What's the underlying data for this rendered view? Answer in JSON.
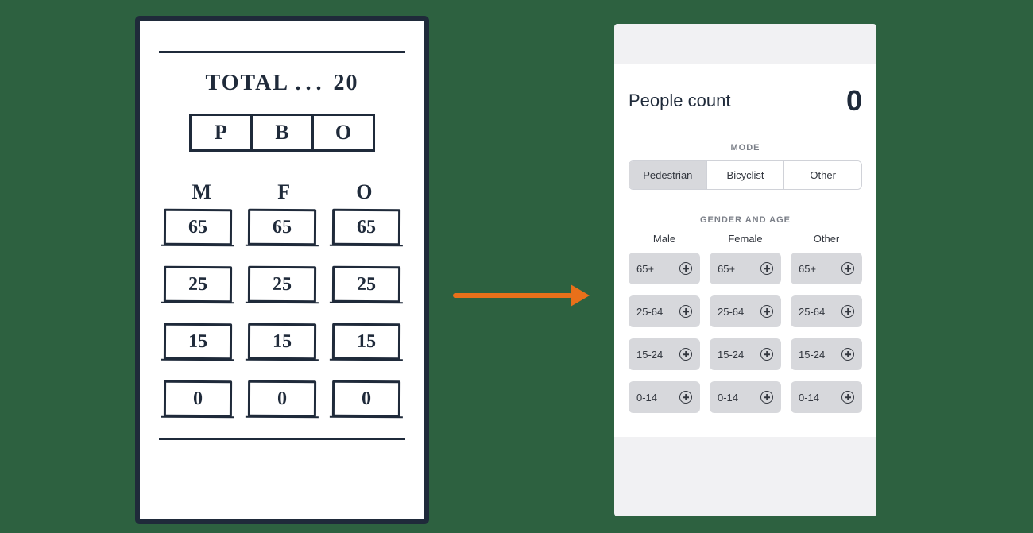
{
  "sketch": {
    "total_label": "TOTAL",
    "total_value": "20",
    "mode_cells": [
      "P",
      "B",
      "O"
    ],
    "gender_heads": [
      "M",
      "F",
      "O"
    ],
    "rows": [
      [
        "65",
        "65",
        "65"
      ],
      [
        "25",
        "25",
        "25"
      ],
      [
        "15",
        "15",
        "15"
      ],
      [
        "0",
        "0",
        "0"
      ]
    ]
  },
  "app": {
    "title": "People count",
    "count": "0",
    "mode_section_label": "MODE",
    "modes": [
      "Pedestrian",
      "Bicyclist",
      "Other"
    ],
    "selected_mode_index": 0,
    "gender_section_label": "GENDER AND AGE",
    "gender_columns": [
      "Male",
      "Female",
      "Other"
    ],
    "age_ranges": [
      "65+",
      "25-64",
      "15-24",
      "0-14"
    ]
  }
}
